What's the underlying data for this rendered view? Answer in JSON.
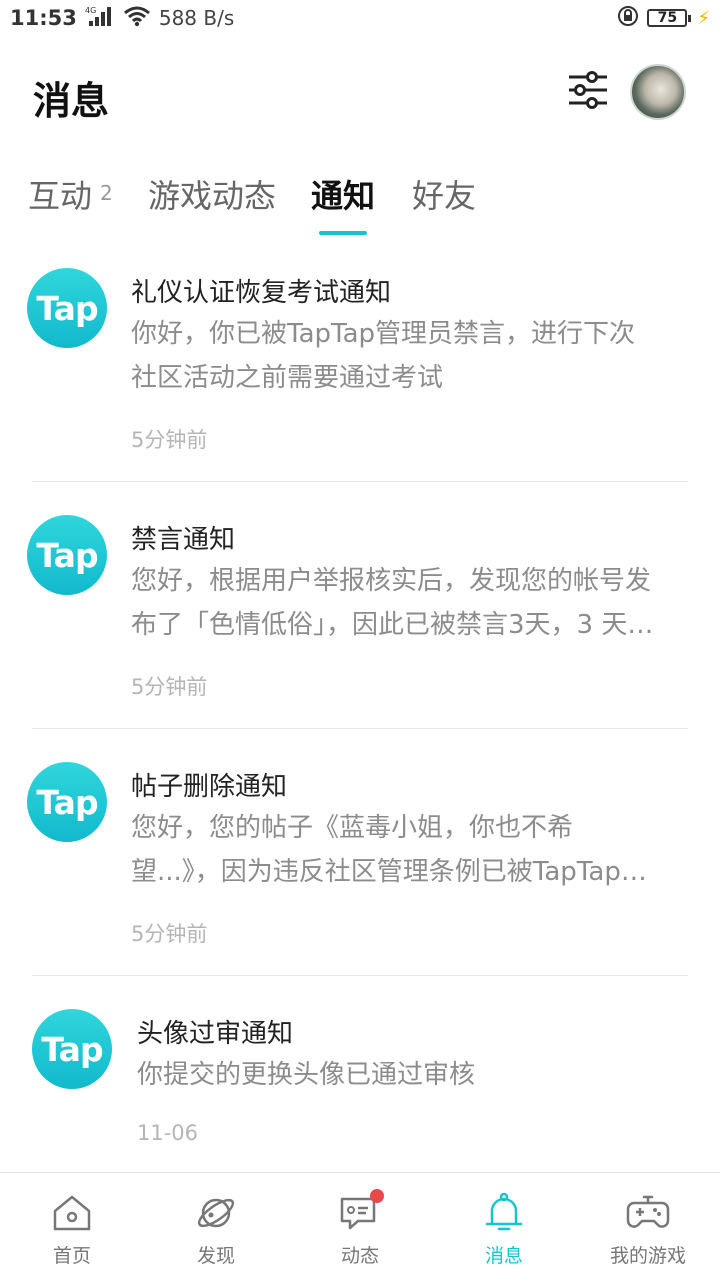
{
  "status_bar": {
    "time": "11:53",
    "network_type": "4G",
    "speed": "588 B/s",
    "battery": "75"
  },
  "header": {
    "title": "消息"
  },
  "tabs": [
    {
      "label": "互动",
      "badge": "2"
    },
    {
      "label": "游戏动态"
    },
    {
      "label": "通知"
    },
    {
      "label": "好友"
    }
  ],
  "active_tab": "通知",
  "notifications": [
    {
      "logo": "Tap",
      "title": "礼仪认证恢复考试通知",
      "body_line1": "你好，你已被TapTap管理员禁言，进行下次",
      "body_line2": "社区活动之前需要通过考试",
      "time": "5分钟前"
    },
    {
      "logo": "Tap",
      "title": "禁言通知",
      "body_line1": "您好，根据用户举报核实后，发现您的帐号发",
      "body_line2": "布了「色情低俗」，因此已被禁言3天，3 天…",
      "time": "5分钟前"
    },
    {
      "logo": "Tap",
      "title": "帖子删除通知",
      "body_line1": "您好，您的帖子《蓝毒小姐，你也不希",
      "body_line2": "望...》，因为违反社区管理条例已被TapTap…",
      "time": "5分钟前"
    },
    {
      "logo": "Tap",
      "title": "头像过审通知",
      "body_line1": "你提交的更换头像已通过审核",
      "body_line2": "",
      "time": "11-06"
    }
  ],
  "bottom_nav": [
    {
      "label": "首页",
      "icon": "home-icon"
    },
    {
      "label": "发现",
      "icon": "planet-icon"
    },
    {
      "label": "动态",
      "icon": "chat-icon"
    },
    {
      "label": "消息",
      "icon": "bell-icon"
    },
    {
      "label": "我的游戏",
      "icon": "gamepad-icon"
    }
  ],
  "colors": {
    "accent": "#15c5ce",
    "badge_red": "#e8484a"
  }
}
